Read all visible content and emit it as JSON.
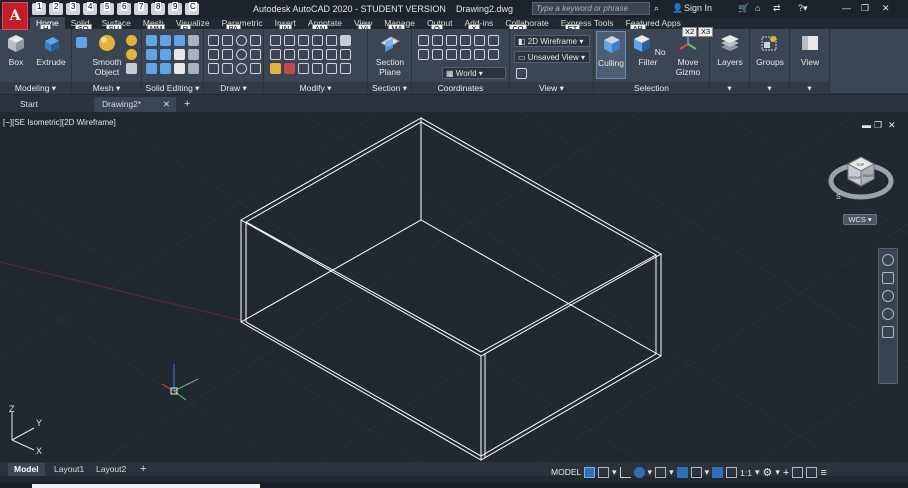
{
  "app": {
    "logo_letter": "A",
    "title": "Autodesk AutoCAD 2020 - STUDENT VERSION",
    "document": "Drawing2.dwg",
    "search_placeholder": "Type a keyword or phrase",
    "sign_in": "Sign In"
  },
  "qat_keys": [
    "1",
    "2",
    "3",
    "4",
    "5",
    "6",
    "7",
    "8",
    "9",
    "C"
  ],
  "tabs": [
    {
      "label": "Home",
      "key": "H",
      "active": true
    },
    {
      "label": "Solid",
      "key": "SO"
    },
    {
      "label": "Surface",
      "key": "SU"
    },
    {
      "label": "Mesh",
      "key": "MM"
    },
    {
      "label": "Visualize",
      "key": "R"
    },
    {
      "label": "Parametric",
      "key": "PA"
    },
    {
      "label": "Insert",
      "key": "IN"
    },
    {
      "label": "Annotate",
      "key": "AN"
    },
    {
      "label": "View",
      "key": "VI"
    },
    {
      "label": "Manage",
      "key": "MA"
    },
    {
      "label": "Output",
      "key": "O"
    },
    {
      "label": "Add-ins",
      "key": "X"
    },
    {
      "label": "Collaborate",
      "key": "CO"
    },
    {
      "label": "Express Tools",
      "key": "ET"
    },
    {
      "label": "Featured Apps",
      "key": "AP"
    }
  ],
  "ribbon": {
    "panels": {
      "modeling": "Modeling",
      "mesh": "Mesh",
      "solid_editing": "Solid Editing",
      "draw": "Draw",
      "modify": "Modify",
      "section": "Section",
      "coordinates": "Coordinates",
      "view": "View",
      "selection": "Selection"
    },
    "buttons": {
      "box": "Box",
      "extrude": "Extrude",
      "smooth_object_1": "Smooth",
      "smooth_object_2": "Object",
      "section_plane_1": "Section",
      "section_plane_2": "Plane",
      "culling": "Culling",
      "no_filter": "No Filter",
      "move_gizmo_1": "Move",
      "move_gizmo_2": "Gizmo",
      "layers": "Layers",
      "groups": "Groups",
      "view_btn": "View"
    },
    "combos": {
      "visual_style": "2D Wireframe",
      "saved_view": "Unsaved View",
      "ucs": "World"
    },
    "keytips": {
      "selection_x2": "X2",
      "selection_x3": "X3"
    }
  },
  "file_tabs": [
    {
      "label": "Start",
      "active": false
    },
    {
      "label": "Drawing2*",
      "active": true
    }
  ],
  "viewport": {
    "label": "[−][SE Isometric][2D Wireframe]",
    "wcs": "WCS",
    "viewcube_top": "TOP",
    "viewcube_front": "FRONT",
    "viewcube_right": "RIGHT",
    "compass_s": "S",
    "axis_x": "X",
    "axis_y": "Y",
    "axis_z": "Z"
  },
  "layout_tabs": [
    {
      "label": "Model",
      "active": true
    },
    {
      "label": "Layout1",
      "active": false
    },
    {
      "label": "Layout2",
      "active": false
    }
  ],
  "status": {
    "model": "MODEL",
    "scale": "1:1"
  },
  "colors": {
    "ribbon_bg": "#3b4553",
    "canvas_bg": "#212830",
    "accent_blue": "#2e6fb8",
    "wire": "#ffffff",
    "logo_red": "#c21f2b"
  }
}
